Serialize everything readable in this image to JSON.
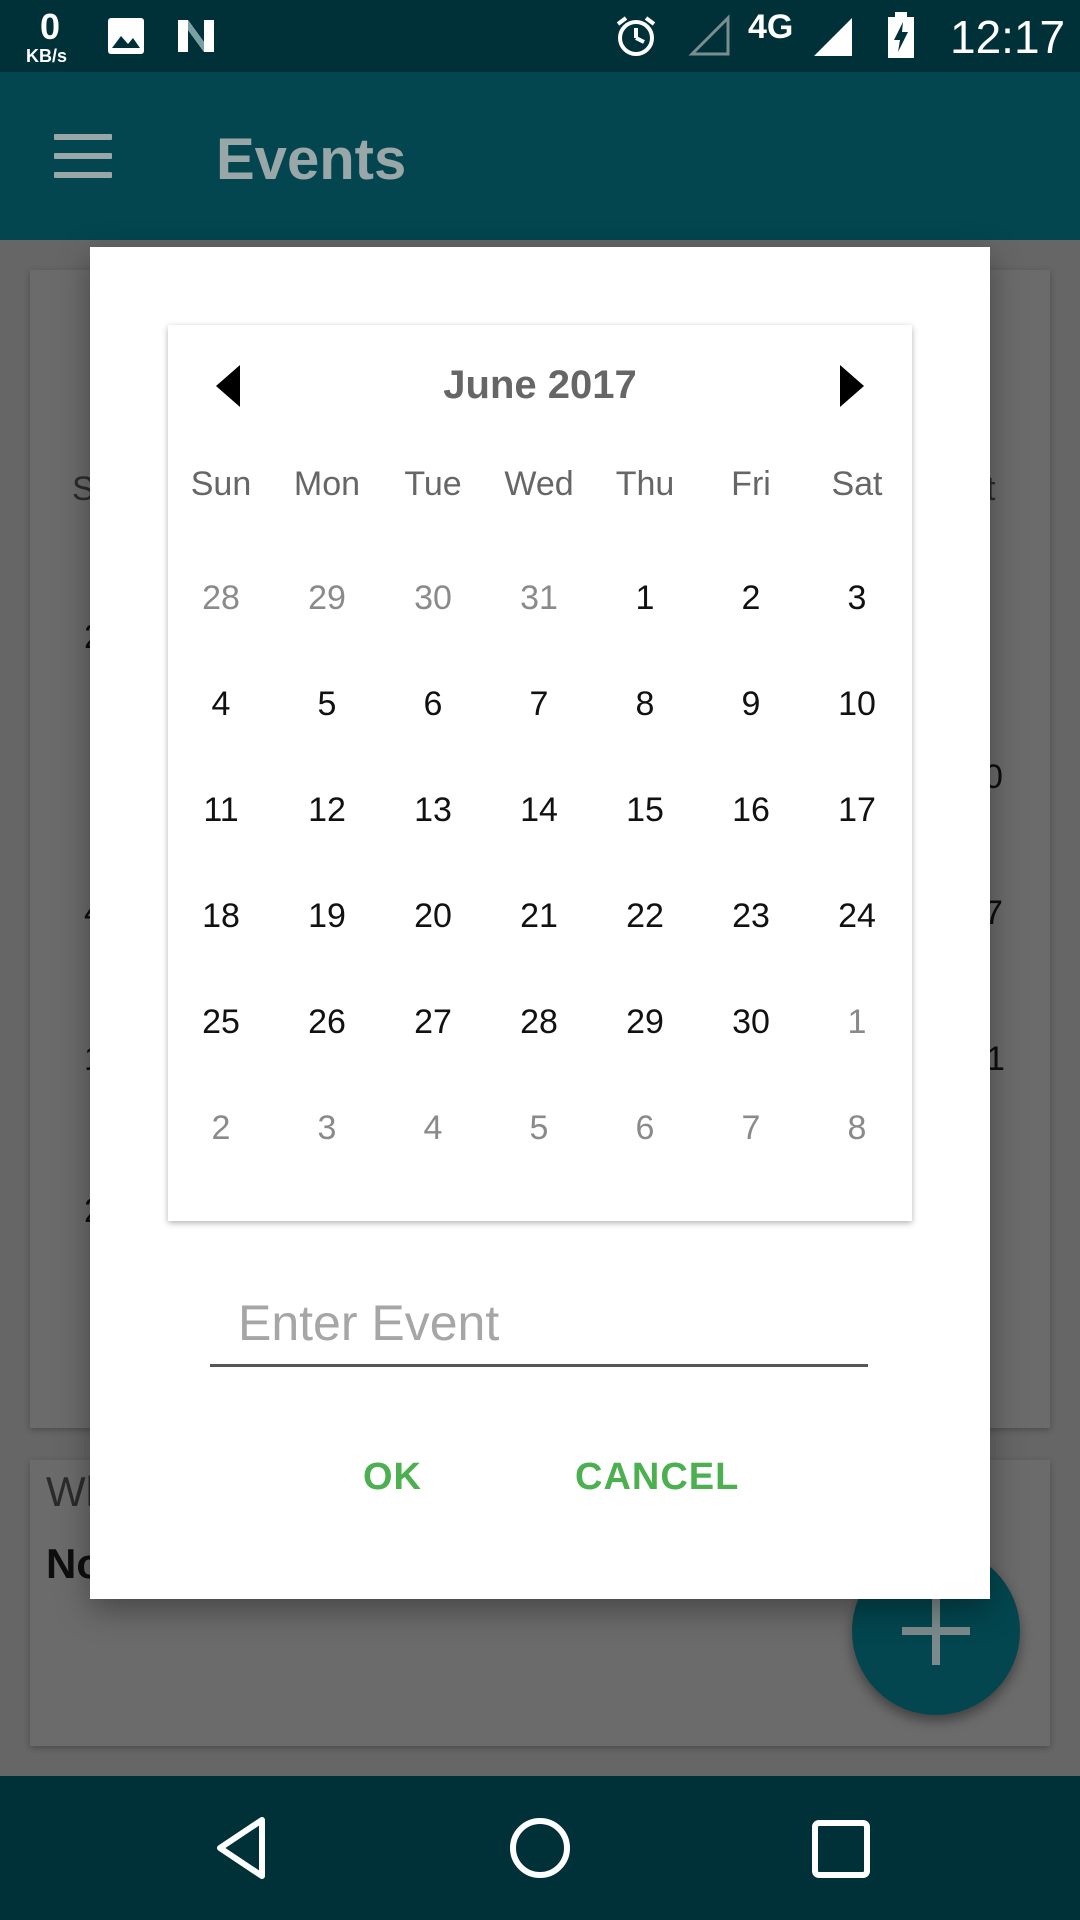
{
  "status_bar": {
    "network_speed": "0",
    "network_unit": "KB/s",
    "network_type": "4G",
    "time": "12:17",
    "icons": [
      "image-icon",
      "n-icon",
      "alarm-icon",
      "signal-empty-icon",
      "signal-icon",
      "battery-charging-icon"
    ]
  },
  "app_bar": {
    "title": "Events"
  },
  "background": {
    "weekday_fragments": [
      "S",
      "t"
    ],
    "date_fragments": [
      "2",
      "0",
      "4",
      "7",
      "1",
      "1",
      "2"
    ],
    "card_label": "Wh",
    "card_value": "No"
  },
  "calendar": {
    "month_label": "June 2017",
    "weekdays": [
      "Sun",
      "Mon",
      "Tue",
      "Wed",
      "Thu",
      "Fri",
      "Sat"
    ],
    "weeks": [
      [
        {
          "d": "28",
          "o": true
        },
        {
          "d": "29",
          "o": true
        },
        {
          "d": "30",
          "o": true
        },
        {
          "d": "31",
          "o": true
        },
        {
          "d": "1",
          "o": false
        },
        {
          "d": "2",
          "o": false
        },
        {
          "d": "3",
          "o": false
        }
      ],
      [
        {
          "d": "4",
          "o": false
        },
        {
          "d": "5",
          "o": false
        },
        {
          "d": "6",
          "o": false
        },
        {
          "d": "7",
          "o": false
        },
        {
          "d": "8",
          "o": false
        },
        {
          "d": "9",
          "o": false
        },
        {
          "d": "10",
          "o": false
        }
      ],
      [
        {
          "d": "11",
          "o": false
        },
        {
          "d": "12",
          "o": false
        },
        {
          "d": "13",
          "o": false
        },
        {
          "d": "14",
          "o": false
        },
        {
          "d": "15",
          "o": false
        },
        {
          "d": "16",
          "o": false
        },
        {
          "d": "17",
          "o": false
        }
      ],
      [
        {
          "d": "18",
          "o": false
        },
        {
          "d": "19",
          "o": false
        },
        {
          "d": "20",
          "o": false
        },
        {
          "d": "21",
          "o": false
        },
        {
          "d": "22",
          "o": false
        },
        {
          "d": "23",
          "o": false
        },
        {
          "d": "24",
          "o": false
        }
      ],
      [
        {
          "d": "25",
          "o": false
        },
        {
          "d": "26",
          "o": false
        },
        {
          "d": "27",
          "o": false
        },
        {
          "d": "28",
          "o": false
        },
        {
          "d": "29",
          "o": false
        },
        {
          "d": "30",
          "o": false
        },
        {
          "d": "1",
          "o": true
        }
      ],
      [
        {
          "d": "2",
          "o": true
        },
        {
          "d": "3",
          "o": true
        },
        {
          "d": "4",
          "o": true
        },
        {
          "d": "5",
          "o": true
        },
        {
          "d": "6",
          "o": true
        },
        {
          "d": "7",
          "o": true
        },
        {
          "d": "8",
          "o": true
        }
      ]
    ]
  },
  "dialog": {
    "event_value": "",
    "event_placeholder": "Enter Event",
    "ok_label": "OK",
    "cancel_label": "CANCEL"
  },
  "colors": {
    "status_bar": "#013138",
    "app_bar": "#03464f",
    "accent": "#4caf50"
  }
}
